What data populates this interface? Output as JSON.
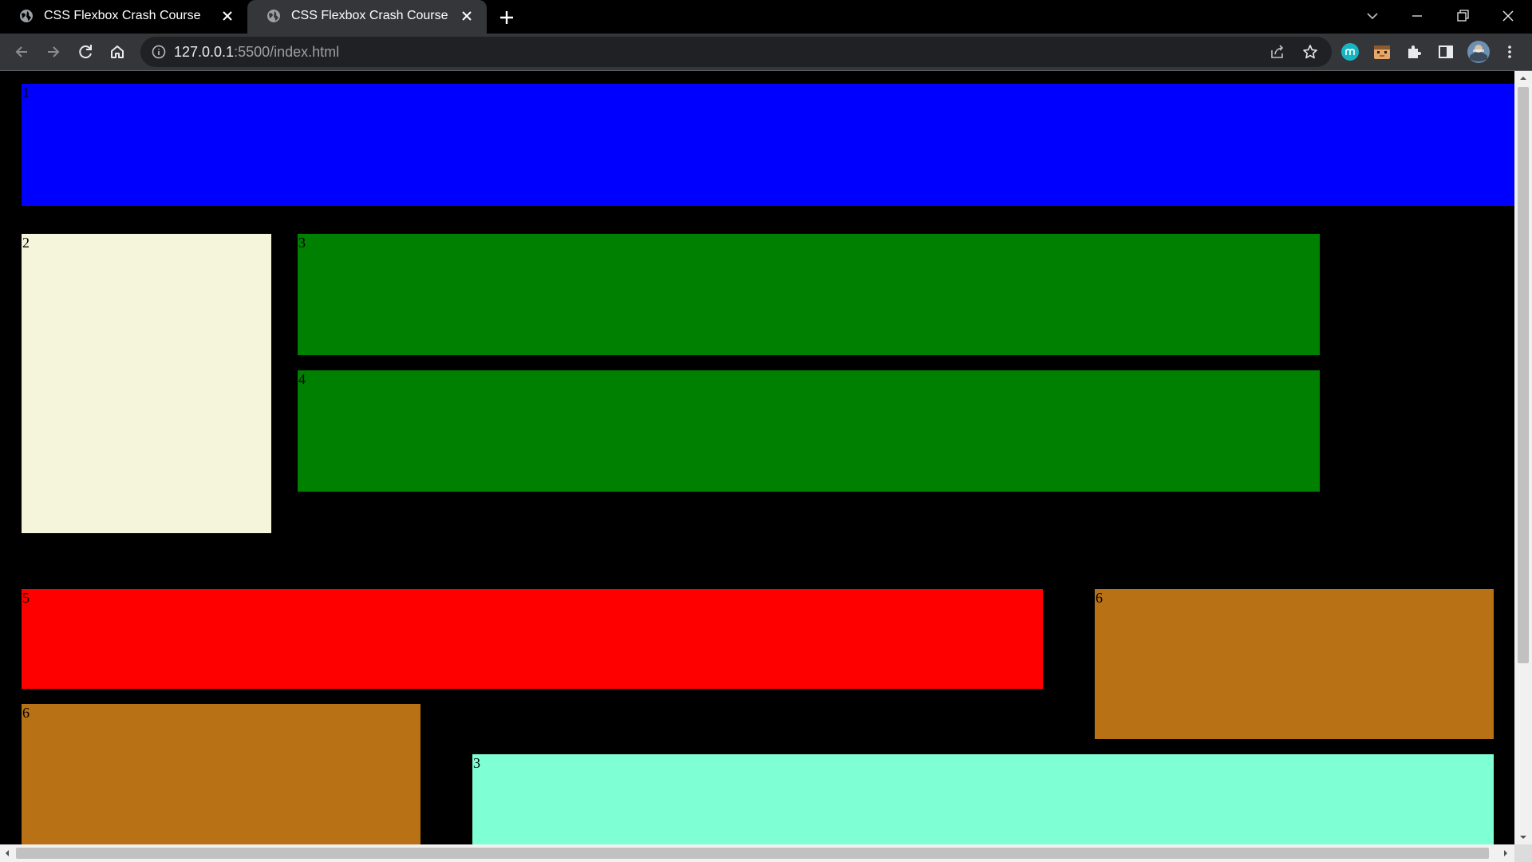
{
  "browser": {
    "tabs": [
      {
        "title": "CSS Flexbox Crash Course",
        "active": false
      },
      {
        "title": "CSS Flexbox Crash Course",
        "active": true
      }
    ],
    "address": {
      "host": "127.0.0.1",
      "rest": ":5500/index.html"
    },
    "icons": {
      "nav": [
        "back-icon",
        "forward-icon",
        "reload-icon",
        "home-icon"
      ],
      "omnibox": [
        "site-info-icon",
        "share-icon",
        "bookmark-star-icon"
      ],
      "toolbar": [
        "extension-m-icon",
        "extension-face-icon",
        "extensions-puzzle-icon",
        "side-panel-icon",
        "profile-avatar",
        "menu-dots-icon"
      ],
      "window": [
        "tab-search-icon",
        "minimize-icon",
        "restore-icon",
        "close-window-icon"
      ]
    }
  },
  "page": {
    "boxes": [
      {
        "label": "1",
        "color": "#0000ff"
      },
      {
        "label": "2",
        "color": "#f5f5dc"
      },
      {
        "label": "3",
        "color": "#008000"
      },
      {
        "label": "4",
        "color": "#008000"
      },
      {
        "label": "5",
        "color": "#ff0000"
      },
      {
        "label": "6",
        "color": "#b87114"
      },
      {
        "label": "6",
        "color": "#b87114"
      },
      {
        "label": "3",
        "color": "#7fffd4"
      }
    ]
  }
}
